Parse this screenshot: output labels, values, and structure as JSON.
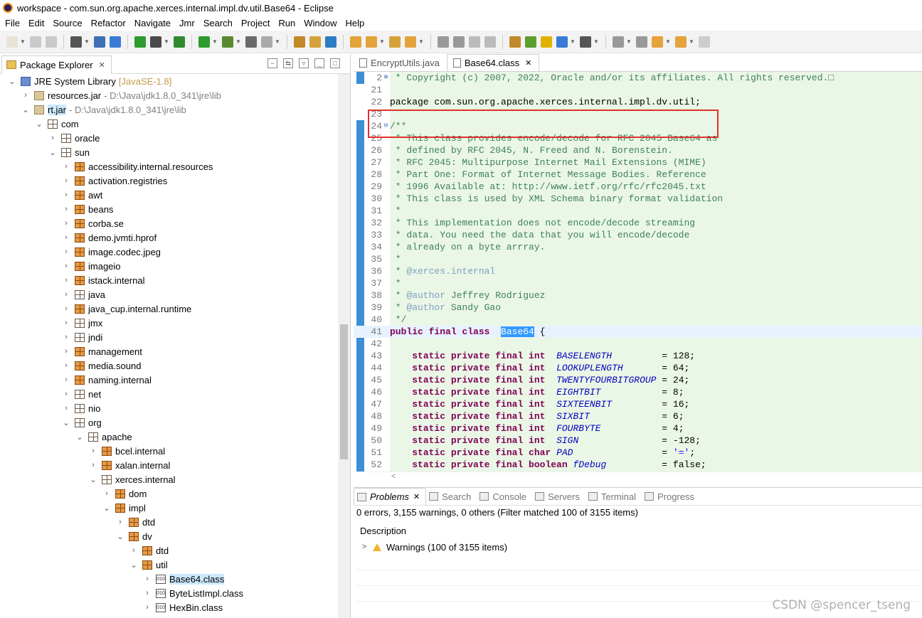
{
  "window": {
    "title": "workspace - com.sun.org.apache.xerces.internal.impl.dv.util.Base64 - Eclipse"
  },
  "menu": [
    "File",
    "Edit",
    "Source",
    "Refactor",
    "Navigate",
    "Jmr",
    "Search",
    "Project",
    "Run",
    "Window",
    "Help"
  ],
  "package_explorer": {
    "tab_label": "Package Explorer",
    "tree": [
      {
        "indent": 1,
        "twisty": "v",
        "icon": "lib",
        "label": "JRE System Library",
        "extra": "[JavaSE-1.8]",
        "extra_style": "sub"
      },
      {
        "indent": 2,
        "twisty": ">",
        "icon": "jar",
        "label": "resources.jar",
        "extra": "- D:\\Java\\jdk1.8.0_341\\jre\\lib",
        "extra_style": "gray"
      },
      {
        "indent": 2,
        "twisty": "v",
        "icon": "jar",
        "label": "rt.jar",
        "extra": "- D:\\Java\\jdk1.8.0_341\\jre\\lib",
        "extra_style": "gray",
        "selected": true
      },
      {
        "indent": 3,
        "twisty": "v",
        "icon": "pkg",
        "label": "com"
      },
      {
        "indent": 4,
        "twisty": ">",
        "icon": "pkg",
        "label": "oracle"
      },
      {
        "indent": 4,
        "twisty": "v",
        "icon": "pkg",
        "label": "sun"
      },
      {
        "indent": 5,
        "twisty": ">",
        "icon": "pkgf",
        "label": "accessibility.internal.resources"
      },
      {
        "indent": 5,
        "twisty": ">",
        "icon": "pkgf",
        "label": "activation.registries"
      },
      {
        "indent": 5,
        "twisty": ">",
        "icon": "pkgf",
        "label": "awt"
      },
      {
        "indent": 5,
        "twisty": ">",
        "icon": "pkgf",
        "label": "beans"
      },
      {
        "indent": 5,
        "twisty": ">",
        "icon": "pkgf",
        "label": "corba.se"
      },
      {
        "indent": 5,
        "twisty": ">",
        "icon": "pkgf",
        "label": "demo.jvmti.hprof"
      },
      {
        "indent": 5,
        "twisty": ">",
        "icon": "pkgf",
        "label": "image.codec.jpeg"
      },
      {
        "indent": 5,
        "twisty": ">",
        "icon": "pkgf",
        "label": "imageio"
      },
      {
        "indent": 5,
        "twisty": ">",
        "icon": "pkgf",
        "label": "istack.internal"
      },
      {
        "indent": 5,
        "twisty": ">",
        "icon": "pkg",
        "label": "java"
      },
      {
        "indent": 5,
        "twisty": ">",
        "icon": "pkgf",
        "label": "java_cup.internal.runtime"
      },
      {
        "indent": 5,
        "twisty": ">",
        "icon": "pkg",
        "label": "jmx"
      },
      {
        "indent": 5,
        "twisty": ">",
        "icon": "pkg",
        "label": "jndi"
      },
      {
        "indent": 5,
        "twisty": ">",
        "icon": "pkgf",
        "label": "management"
      },
      {
        "indent": 5,
        "twisty": ">",
        "icon": "pkgf",
        "label": "media.sound"
      },
      {
        "indent": 5,
        "twisty": ">",
        "icon": "pkgf",
        "label": "naming.internal"
      },
      {
        "indent": 5,
        "twisty": ">",
        "icon": "pkg",
        "label": "net"
      },
      {
        "indent": 5,
        "twisty": ">",
        "icon": "pkg",
        "label": "nio"
      },
      {
        "indent": 5,
        "twisty": "v",
        "icon": "pkg",
        "label": "org"
      },
      {
        "indent": 6,
        "twisty": "v",
        "icon": "pkg",
        "label": "apache"
      },
      {
        "indent": 7,
        "twisty": ">",
        "icon": "pkgf",
        "label": "bcel.internal"
      },
      {
        "indent": 7,
        "twisty": ">",
        "icon": "pkgf",
        "label": "xalan.internal"
      },
      {
        "indent": 7,
        "twisty": "v",
        "icon": "pkg",
        "label": "xerces.internal"
      },
      {
        "indent": 8,
        "twisty": ">",
        "icon": "pkgf",
        "label": "dom"
      },
      {
        "indent": 8,
        "twisty": "v",
        "icon": "pkgf",
        "label": "impl"
      },
      {
        "indent": 9,
        "twisty": ">",
        "icon": "pkgf",
        "label": "dtd"
      },
      {
        "indent": 9,
        "twisty": "v",
        "icon": "pkgf",
        "label": "dv"
      },
      {
        "indent": 10,
        "twisty": ">",
        "icon": "pkgf",
        "label": "dtd"
      },
      {
        "indent": 10,
        "twisty": "v",
        "icon": "pkgf",
        "label": "util"
      },
      {
        "indent": 11,
        "twisty": ">",
        "icon": "cls",
        "label": "Base64.class",
        "selected": true
      },
      {
        "indent": 11,
        "twisty": ">",
        "icon": "cls",
        "label": "ByteListImpl.class"
      },
      {
        "indent": 11,
        "twisty": ">",
        "icon": "cls",
        "label": "HexBin.class"
      }
    ]
  },
  "editor": {
    "tabs": [
      {
        "label": "EncryptUtils.java",
        "active": false
      },
      {
        "label": "Base64.class",
        "active": true
      }
    ],
    "lines": [
      {
        "n": "2",
        "marker": "⊕",
        "html": "<span class='cm'> * Copyright (c) 2007, 2022, Oracle and/or its affiliates. All rights reserved.&#9633;</span>"
      },
      {
        "n": "21",
        "html": ""
      },
      {
        "n": "22",
        "html": "package com.sun.org.apache.xerces.internal.impl.dv.util;"
      },
      {
        "n": "23",
        "html": ""
      },
      {
        "n": "24",
        "marker": "⊖",
        "html": "<span class='cm'>/**</span>"
      },
      {
        "n": "25",
        "html": "<span class='cm'> * This class provides encode/decode for RFC 2045 Base64 as</span>"
      },
      {
        "n": "26",
        "html": "<span class='cm'> * defined by RFC 2045, N. Freed and N. Borenstein.</span>"
      },
      {
        "n": "27",
        "html": "<span class='cm'> * RFC 2045: Multipurpose Internet Mail Extensions (MIME)</span>"
      },
      {
        "n": "28",
        "html": "<span class='cm'> * Part One: Format of Internet Message Bodies. Reference</span>"
      },
      {
        "n": "29",
        "html": "<span class='cm'> * 1996 Available at: http://www.ietf.org/rfc/rfc2045.txt</span>"
      },
      {
        "n": "30",
        "html": "<span class='cm'> * This class is used by XML Schema binary format validation</span>"
      },
      {
        "n": "31",
        "html": "<span class='cm'> *</span>"
      },
      {
        "n": "32",
        "html": "<span class='cm'> * This implementation does not encode/decode streaming</span>"
      },
      {
        "n": "33",
        "html": "<span class='cm'> * data. You need the data that you will encode/decode</span>"
      },
      {
        "n": "34",
        "html": "<span class='cm'> * already on a byte arrray.</span>"
      },
      {
        "n": "35",
        "html": "<span class='cm'> *</span>"
      },
      {
        "n": "36",
        "html": "<span class='cm'> * </span><span class='cmd'>@xerces.internal</span>"
      },
      {
        "n": "37",
        "html": "<span class='cm'> *</span>"
      },
      {
        "n": "38",
        "html": "<span class='cm'> * </span><span class='cmd'>@author</span><span class='cm'> Jeffrey Rodriguez</span>"
      },
      {
        "n": "39",
        "html": "<span class='cm'> * </span><span class='cmd'>@author</span><span class='cm'> Sandy Gao</span>"
      },
      {
        "n": "40",
        "html": "<span class='cm'> */</span>"
      },
      {
        "n": "41",
        "hl": true,
        "html": "<span class='kw'>public final class</span>  <span class='selw'>Base64</span> {"
      },
      {
        "n": "42",
        "html": ""
      },
      {
        "n": "43",
        "html": "    <span class='kw'>static private final int</span>  <span class='fld'>BASELENGTH</span>         = 128;"
      },
      {
        "n": "44",
        "html": "    <span class='kw'>static private final int</span>  <span class='fld'>LOOKUPLENGTH</span>       = 64;"
      },
      {
        "n": "45",
        "html": "    <span class='kw'>static private final int</span>  <span class='fld'>TWENTYFOURBITGROUP</span> = 24;"
      },
      {
        "n": "46",
        "html": "    <span class='kw'>static private final int</span>  <span class='fld'>EIGHTBIT</span>           = 8;"
      },
      {
        "n": "47",
        "html": "    <span class='kw'>static private final int</span>  <span class='fld'>SIXTEENBIT</span>         = 16;"
      },
      {
        "n": "48",
        "html": "    <span class='kw'>static private final int</span>  <span class='fld'>SIXBIT</span>             = 6;"
      },
      {
        "n": "49",
        "html": "    <span class='kw'>static private final int</span>  <span class='fld'>FOURBYTE</span>           = 4;"
      },
      {
        "n": "50",
        "html": "    <span class='kw'>static private final int</span>  <span class='fld'>SIGN</span>               = -128;"
      },
      {
        "n": "51",
        "html": "    <span class='kw'>static private final char</span> <span class='fld'>PAD</span>                = <span class='str'>'='</span>;"
      },
      {
        "n": "52",
        "html": "    <span class='kw'>static private final boolean</span> <span class='fld'>fDebug</span>          = false;"
      }
    ]
  },
  "problems": {
    "tabs": [
      {
        "label": "Problems",
        "active": true
      },
      {
        "label": "Search"
      },
      {
        "label": "Console"
      },
      {
        "label": "Servers"
      },
      {
        "label": "Terminal"
      },
      {
        "label": "Progress"
      }
    ],
    "summary": "0 errors, 3,155 warnings, 0 others (Filter matched 100 of 3155 items)",
    "column_header": "Description",
    "warning_row": "Warnings (100 of 3155 items)"
  },
  "watermark": "CSDN @spencer_tseng",
  "colors": {
    "accent_selection": "#cce8ff",
    "code_bg": "#eaf7e6",
    "highlight_box": "#e0312a"
  }
}
